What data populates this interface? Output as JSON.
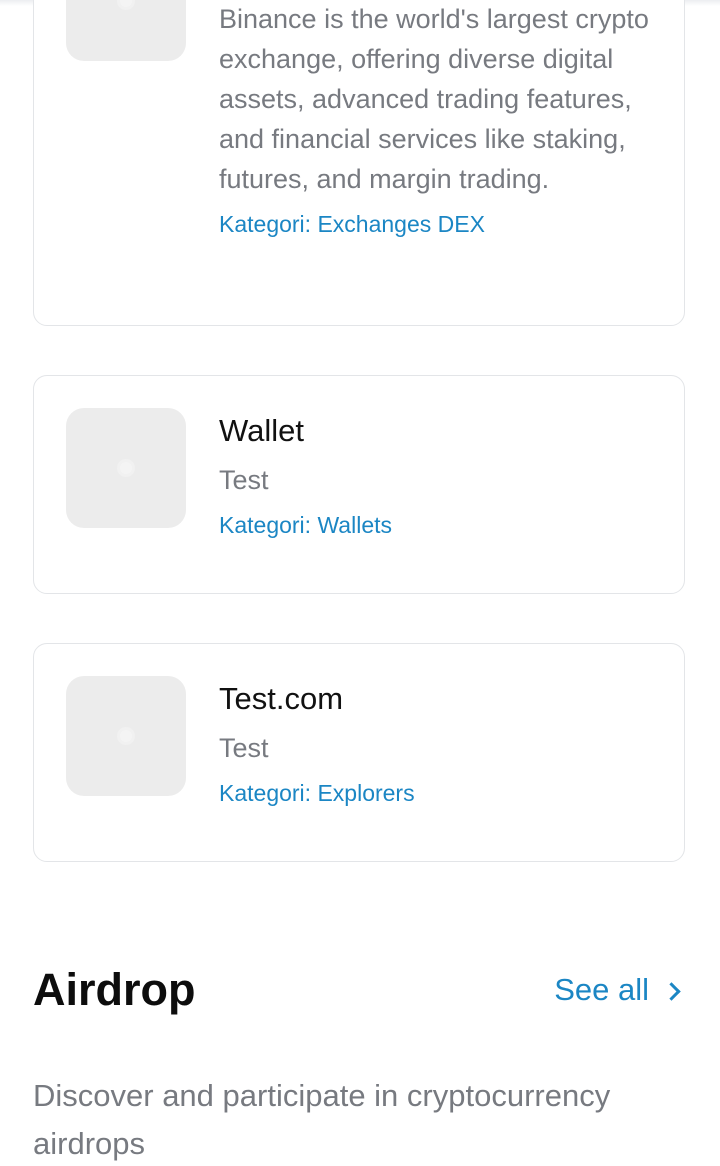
{
  "cards": [
    {
      "title": "",
      "description": "Binance is the world's largest crypto exchange, offering diverse digital assets, advanced trading features, and financial services like staking, futures, and margin trading.",
      "category": "Kategori: Exchanges DEX"
    },
    {
      "title": "Wallet",
      "description": "Test",
      "category": "Kategori: Wallets"
    },
    {
      "title": "Test.com",
      "description": "Test",
      "category": "Kategori: Explorers"
    }
  ],
  "airdrop": {
    "title": "Airdrop",
    "see_all_label": "See all",
    "description": "Discover and participate in cryptocurrency airdrops"
  },
  "colors": {
    "accent": "#1b86c4",
    "muted_text": "#777a80",
    "border": "#e3e5e8"
  }
}
